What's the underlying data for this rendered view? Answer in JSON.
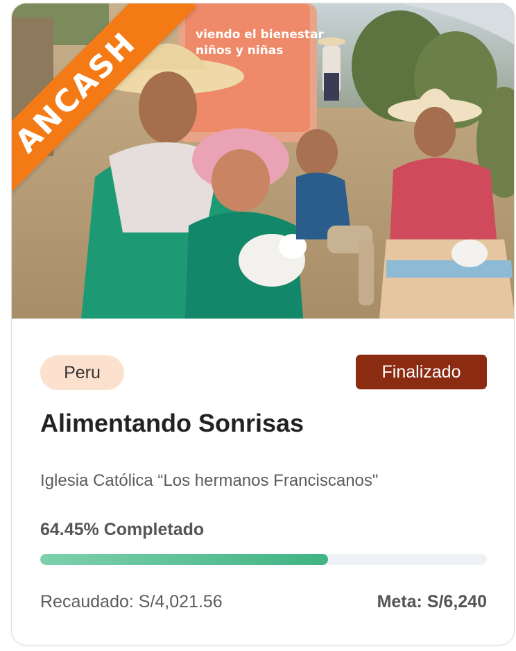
{
  "project": {
    "region_ribbon": "ANCASH",
    "banner_text_line1": "viendo el bienestar",
    "banner_text_line2": "niños y niñas",
    "country": "Peru",
    "status": "Finalizado",
    "title": "Alimentando Sonrisas",
    "organization": "Iglesia Católica “Los hermanos Franciscanos\"",
    "progress_label": "64.45% Completado",
    "progress_percent": 64.45,
    "raised_label": "Recaudado: S/4,021.56",
    "goal_label": "Meta: S/6,240"
  },
  "colors": {
    "ribbon": "#f47a16",
    "country_badge_bg": "#fde1cf",
    "status_badge_bg": "#8a2b12",
    "progress_fill": "#3fb383",
    "progress_track": "#eef2f6"
  }
}
